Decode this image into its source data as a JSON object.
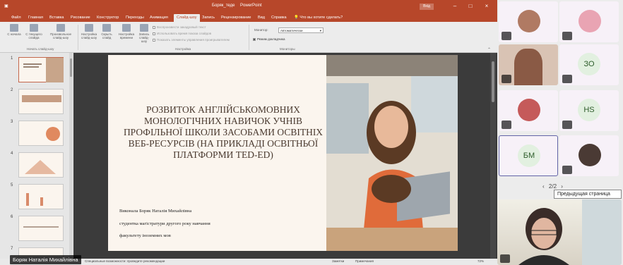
{
  "ppt": {
    "file_title": "Боряк_теде",
    "app_name": "PowerPoint",
    "signin_label": "Вхід",
    "tabs": [
      "Файл",
      "Главная",
      "Вставка",
      "Рисование",
      "Конструктор",
      "Переходы",
      "Анимация",
      "Слайд-шоу",
      "Запись",
      "Рецензирование",
      "Вид",
      "Справка",
      "Что вы хотите сделать?"
    ],
    "active_tab_index": 7,
    "ribbon": {
      "start_label": "С начала",
      "from_current_label": "С текущего слайда",
      "online_label": "Произвольное слайд-шоу",
      "start_group": "Начать слайд-шоу",
      "setup_label": "Настройка слайд-шоу",
      "hide_label": "Скрыть слайд",
      "rehearse_label": "Настройка времени",
      "record_label": "Запись слайд-шоу",
      "check1": "Воспроизвести закадровый текст",
      "check2": "Использовать время показа слайдов",
      "check3": "Показать элементы управления проигрывателем",
      "setup_group": "Настройка",
      "monitor_label": "Монитор:",
      "monitor_value": "Автоматически",
      "presenter_view": "Режим докладчика",
      "monitors_group": "Мониторы"
    },
    "slide_numbers": [
      "1",
      "2",
      "3",
      "4",
      "5",
      "6",
      "7"
    ],
    "slide": {
      "title": "Розвиток англійськомовних монологічних навичок учнів профільної школи засобами освітніх веб-ресурсів (на прикладі освітньої платформи TED-ED)",
      "author_line1": "Виконала Боряк Наталія Михайлівна",
      "author_line2": "студентка магістратури другого року навчання",
      "author_line3": "факультету іноземних мов"
    },
    "status": {
      "accessibility": "Специальные возможности: проведите рекомендации",
      "notes": "Заметки",
      "comments": "Примечания",
      "zoom": "72%"
    }
  },
  "presenter_name": "Боряк Наталія Михайлівна",
  "teams": {
    "participants": [
      {
        "initials": ""
      },
      {
        "initials": ""
      },
      {
        "initials": ""
      },
      {
        "initials": "ЗО"
      },
      {
        "initials": ""
      },
      {
        "initials": "HS"
      },
      {
        "initials": "БМ"
      },
      {
        "initials": ""
      }
    ],
    "pager": "2/2",
    "tooltip": "Предыдущая страница"
  },
  "colors": {
    "accent": "#b7472a",
    "teams": "#6264a7"
  }
}
